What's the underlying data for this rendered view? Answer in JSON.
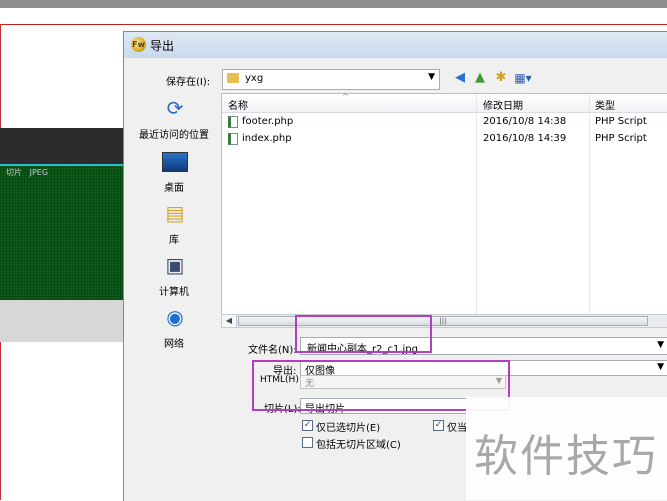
{
  "background_app": {
    "slice_label": "切片   JPEG"
  },
  "dialog": {
    "title": "导出",
    "title_icon": "app-logo-icon",
    "save_in": {
      "label": "保存在(I):",
      "value": "yxg"
    },
    "toolbar": {
      "back_icon": "back-arrow-icon",
      "up_icon": "up-folder-icon",
      "new_folder_icon": "new-folder-icon",
      "view_icon": "view-menu-icon"
    },
    "places": [
      {
        "label": "最近访问的位置",
        "icon": "recent-places-icon"
      },
      {
        "label": "桌面",
        "icon": "desktop-icon"
      },
      {
        "label": "库",
        "icon": "library-icon"
      },
      {
        "label": "计算机",
        "icon": "computer-icon"
      },
      {
        "label": "网络",
        "icon": "network-icon"
      }
    ],
    "file_list": {
      "columns": [
        "名称",
        "修改日期",
        "类型"
      ],
      "files": [
        {
          "name": "footer.php",
          "date": "2016/10/8 14:38",
          "type": "PHP Script"
        },
        {
          "name": "index.php",
          "date": "2016/10/8 14:39",
          "type": "PHP Script"
        }
      ]
    },
    "filename": {
      "label": "文件名(N):",
      "value": "新闻中心副本_r2_c1.jpg"
    },
    "export": {
      "label": "导出:",
      "value": "仅图像"
    },
    "html": {
      "label": "HTML(H):",
      "value": "无"
    },
    "slices": {
      "label": "切片(L):",
      "value": "导出切片"
    },
    "checkboxes": [
      {
        "label": "仅已选切片(E)",
        "checked": true
      },
      {
        "label": "仅当",
        "checked": true
      },
      {
        "label": "包括无切片区域(C)",
        "checked": false
      }
    ]
  },
  "watermark": "软件技巧",
  "colors": {
    "highlight": "#b040c0",
    "dialog_bg": "#f0f0f0",
    "titlebar": "#c9d9ee"
  }
}
